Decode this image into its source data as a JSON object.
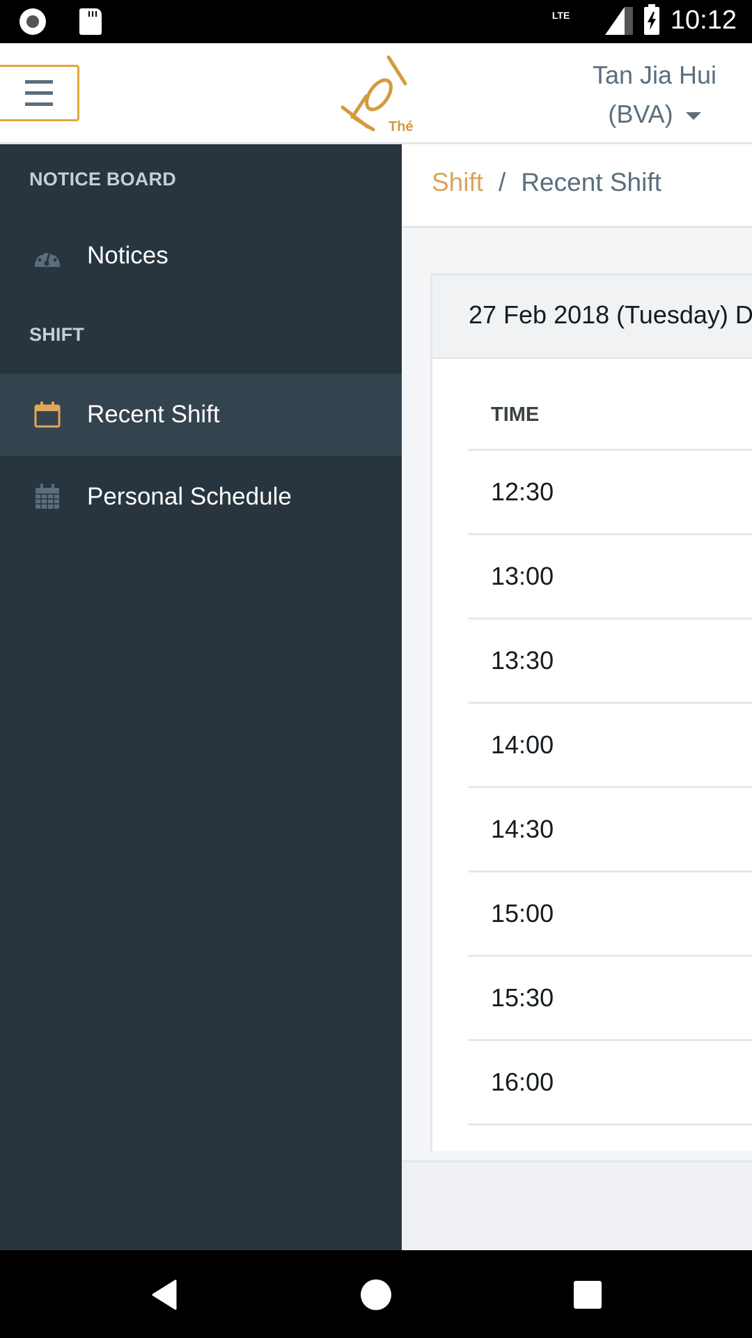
{
  "status_bar": {
    "time": "10:12",
    "network": "LTE",
    "icons": [
      "record-icon",
      "sd-card-icon",
      "lte-signal-icon",
      "battery-charging-icon"
    ]
  },
  "header": {
    "menu_icon": "hamburger-icon",
    "logo_text": "KOI",
    "logo_subtext": "Thé",
    "user_name": "Tan Jia Hui",
    "user_branch": "(BVA)",
    "brand_color": "#d8a55a",
    "accent_border_color": "#e2a73b"
  },
  "sidebar": {
    "sections": [
      {
        "title": "NOTICE BOARD",
        "items": [
          {
            "label": "Notices",
            "icon": "dashboard-gauge-icon",
            "active": false
          }
        ]
      },
      {
        "title": "SHIFT",
        "items": [
          {
            "label": "Recent Shift",
            "icon": "calendar-icon",
            "active": true
          },
          {
            "label": "Personal Schedule",
            "icon": "calendar-grid-icon",
            "active": false
          }
        ]
      }
    ]
  },
  "breadcrumb": {
    "parent": "Shift",
    "separator": "/",
    "current": "Recent Shift"
  },
  "card": {
    "header": "27 Feb 2018 (Tuesday) D",
    "table": {
      "columns": [
        "TIME"
      ],
      "rows": [
        "12:30",
        "13:00",
        "13:30",
        "14:00",
        "14:30",
        "15:00",
        "15:30",
        "16:00"
      ]
    }
  },
  "nav_bar": {
    "buttons": [
      "back-icon",
      "home-icon",
      "recents-icon"
    ]
  }
}
